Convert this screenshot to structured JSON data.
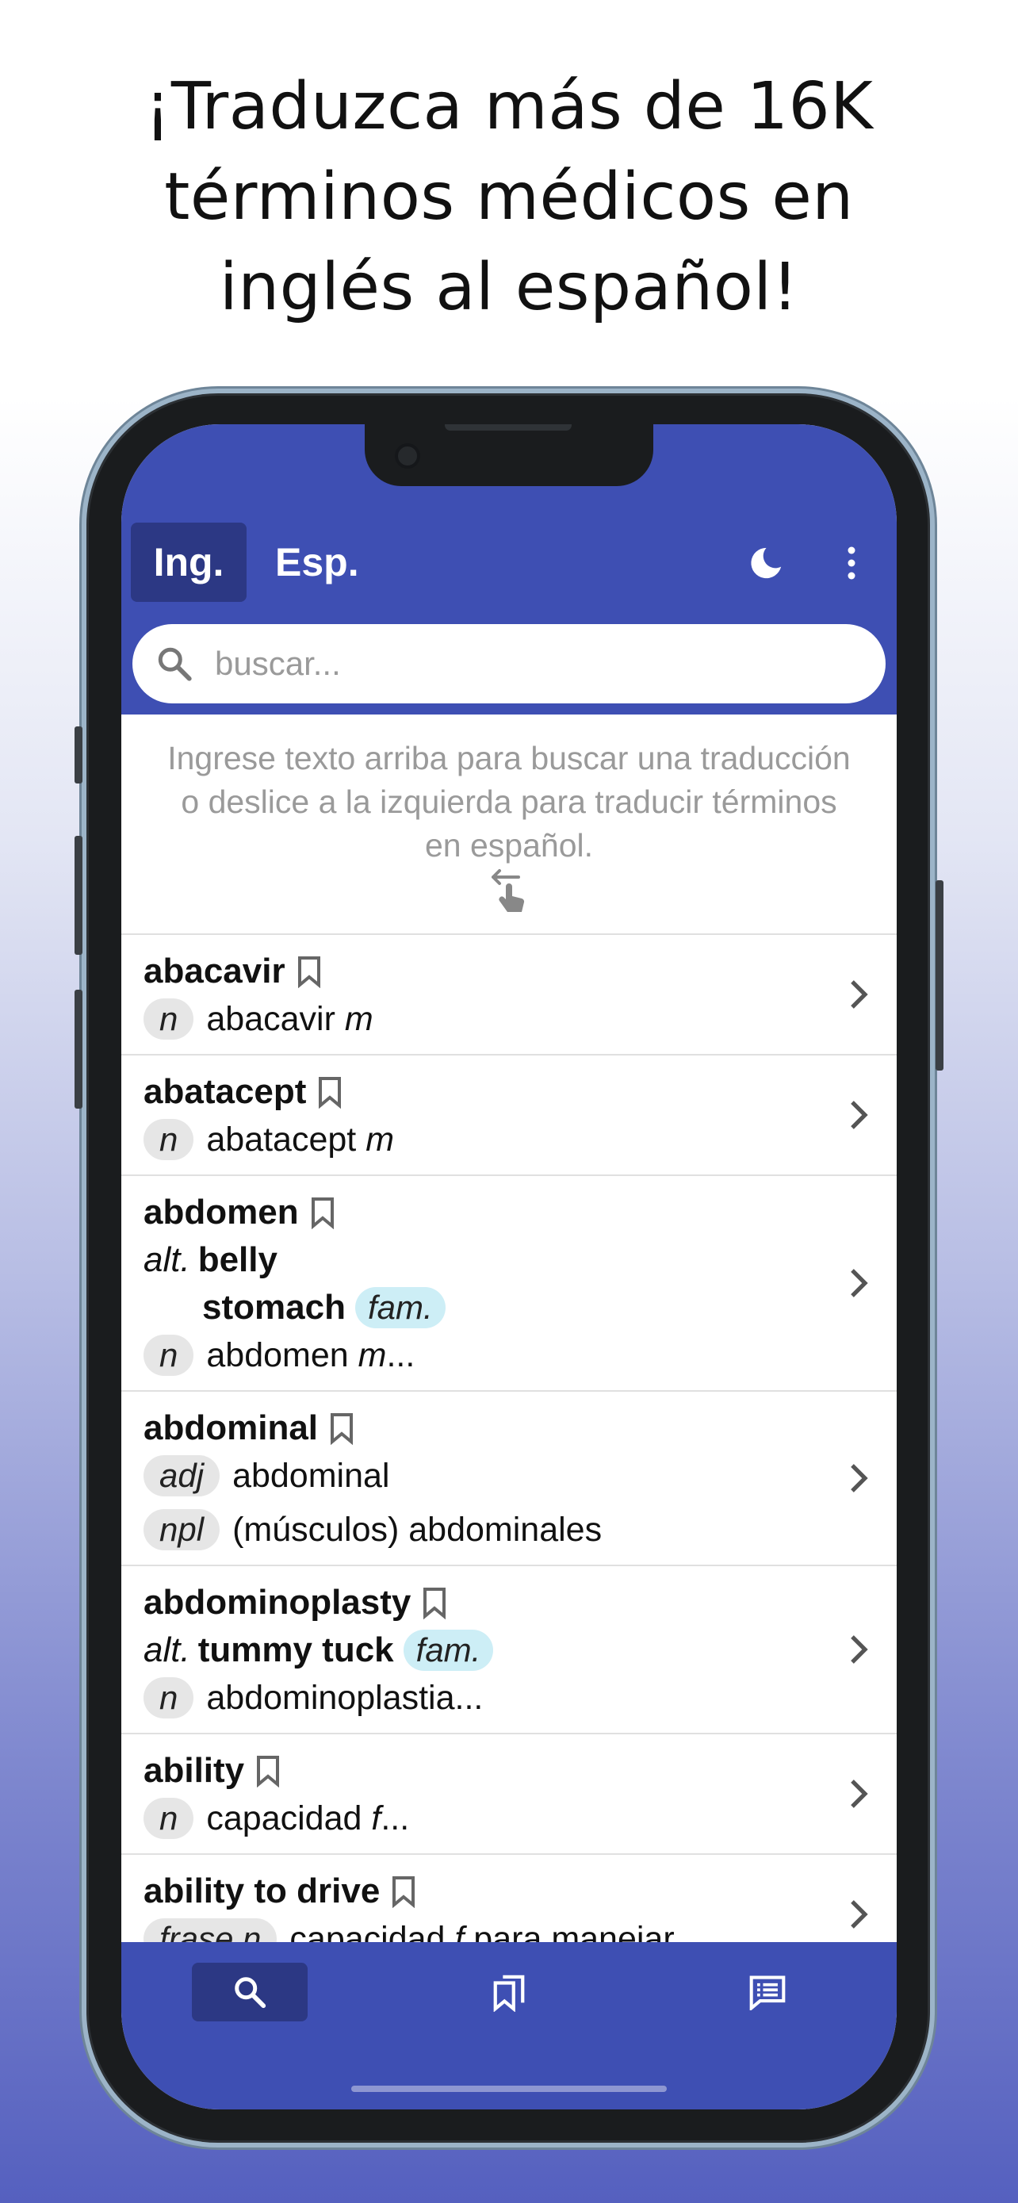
{
  "headline": {
    "line1": "¡Traduzca más de 16K",
    "line2": "términos médicos en",
    "line3": "inglés al español!"
  },
  "colors": {
    "primary": "#3e4fb3",
    "primary_dark": "#2c3884",
    "fam_badge": "#cdeef6",
    "pos_badge": "#e6e6e6"
  },
  "header": {
    "tab_english": "Ing.",
    "tab_spanish": "Esp.",
    "dark_mode_icon": "moon-icon",
    "menu_icon": "more-vertical-icon"
  },
  "search": {
    "placeholder": "buscar...",
    "value": ""
  },
  "intro": {
    "line1": "Ingrese texto arriba para buscar una traducción",
    "line2": "o deslice a la izquierda para traducir términos",
    "line3": "en español.",
    "icon": "swipe-left-icon"
  },
  "entries": [
    {
      "term": "abacavir",
      "pos": "n",
      "translation": "abacavir ",
      "gender": "m",
      "suffix": ""
    },
    {
      "term": "abatacept",
      "pos": "n",
      "translation": "abatacept ",
      "gender": "m",
      "suffix": ""
    },
    {
      "term": "abdomen",
      "alt_label": "alt.",
      "alt1": "belly",
      "alt2": "stomach",
      "alt2_tag": "fam.",
      "pos": "n",
      "translation": "abdomen ",
      "gender": "m",
      "suffix": "..."
    },
    {
      "term": "abdominal",
      "pos": "adj",
      "translation": "abdominal",
      "pos2": "npl",
      "translation2": "(músculos) abdominales"
    },
    {
      "term": "abdominoplasty",
      "alt_label": "alt.",
      "alt1": "tummy tuck",
      "alt1_tag": "fam.",
      "pos": "n",
      "translation": "abdominoplastia..."
    },
    {
      "term": "ability",
      "pos": "n",
      "translation": "capacidad ",
      "gender": "f",
      "suffix": "..."
    },
    {
      "term": "ability to drive",
      "pos": "frase n",
      "translation": "capacidad ",
      "gender": "f",
      "suffix": " para manejar"
    }
  ],
  "bottom_nav": {
    "search_icon": "search-icon",
    "bookmarks_icon": "bookmarks-icon",
    "glossary_icon": "glossary-icon"
  }
}
